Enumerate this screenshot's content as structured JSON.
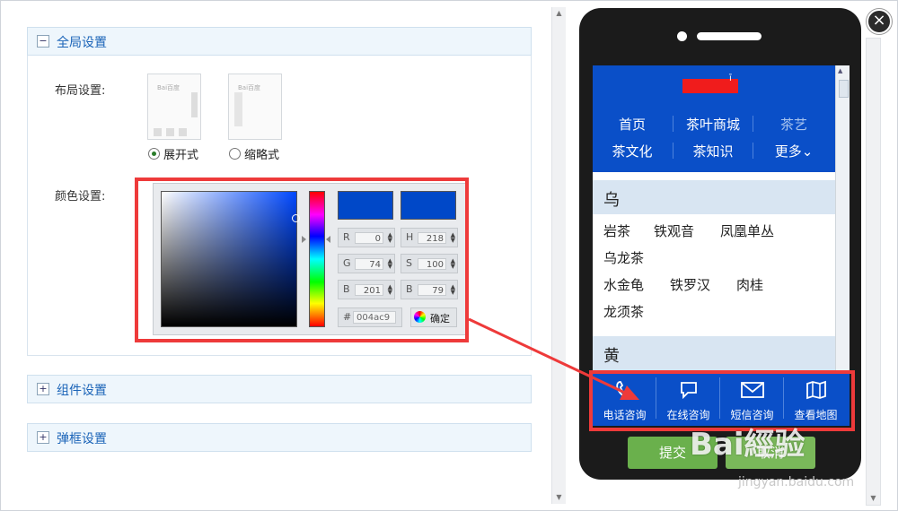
{
  "sections": {
    "global": {
      "title": "全局设置",
      "toggle": "−"
    },
    "components": {
      "title": "组件设置",
      "toggle": "+"
    },
    "dialog": {
      "title": "弹框设置",
      "toggle": "+"
    }
  },
  "layout": {
    "label": "布局设置:",
    "thumb_logo": "Bai百度",
    "options": [
      {
        "label": "展开式",
        "selected": true
      },
      {
        "label": "缩略式",
        "selected": false
      }
    ]
  },
  "color": {
    "label": "颜色设置:",
    "current_hex": "#004ac9",
    "fields": {
      "r": {
        "key": "R",
        "value": "0"
      },
      "g": {
        "key": "G",
        "value": "74"
      },
      "b": {
        "key": "B",
        "value": "201"
      },
      "h": {
        "key": "H",
        "value": "218"
      },
      "s": {
        "key": "S",
        "value": "100"
      },
      "bri": {
        "key": "B",
        "value": "79"
      }
    },
    "hex_key": "#",
    "hex_value": "004ac9",
    "ok_label": "确定"
  },
  "mobile": {
    "logo_text": "ī",
    "nav": [
      "首页",
      "茶叶商城",
      "茶艺",
      "茶文化",
      "茶知识",
      "更多⌄"
    ],
    "cat1": "乌",
    "items1_row1": [
      "岩茶",
      "铁观音",
      "凤凰单丛"
    ],
    "items1_row2": [
      "乌龙茶"
    ],
    "items1_row3": [
      "水金龟",
      "铁罗汉",
      "肉桂"
    ],
    "items1_row4": [
      "龙须茶"
    ],
    "cat2": "黄",
    "bar": [
      {
        "label": "电话咨询",
        "icon": "phone-icon"
      },
      {
        "label": "在线咨询",
        "icon": "chat-icon"
      },
      {
        "label": "短信咨询",
        "icon": "mail-icon"
      },
      {
        "label": "查看地图",
        "icon": "map-icon"
      }
    ]
  },
  "buttons": {
    "submit": "提交",
    "cancel": "取消",
    "close": "×"
  },
  "watermark": {
    "brand": "Bai經验",
    "url": "jingyan.baidu.com"
  },
  "colors": {
    "accent": "#0a4fc8",
    "highlight": "#ee3a3a",
    "submit": "#6ab04c"
  }
}
